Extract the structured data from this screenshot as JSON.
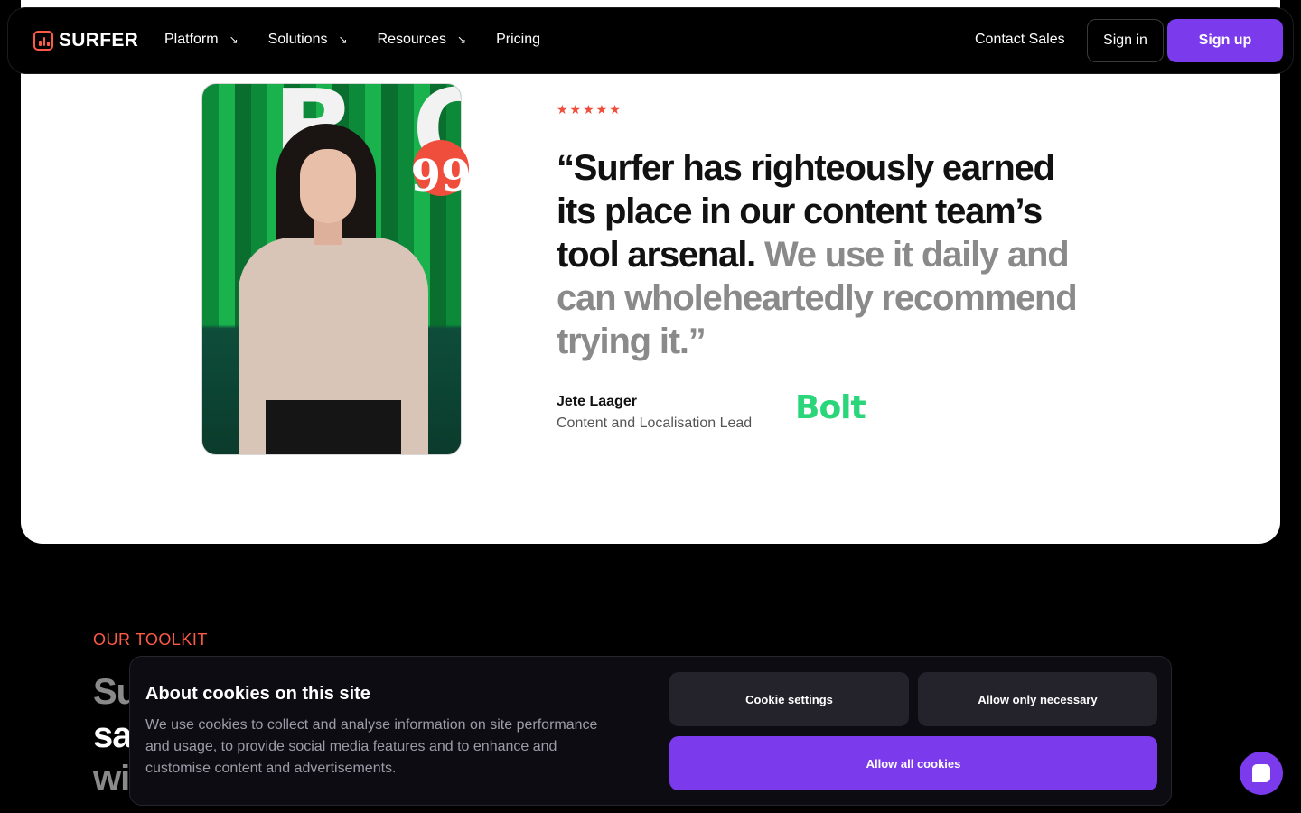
{
  "nav": {
    "logo_text": "SURFER",
    "links": [
      {
        "label": "Platform",
        "arrow": "↘"
      },
      {
        "label": "Solutions",
        "arrow": "↘"
      },
      {
        "label": "Resources",
        "arrow": "↘"
      },
      {
        "label": "Pricing",
        "arrow": ""
      }
    ],
    "contact_sales": "Contact Sales",
    "sign_in": "Sign in",
    "sign_up": "Sign up"
  },
  "testimonial": {
    "rating_stars": "★★★★★",
    "quote_mark": "99",
    "quote_strong": "“Surfer has righteously earned its place in our content team’s tool arsenal.",
    "quote_muted": " We use it daily and can wholeheartedly recommend trying it.”",
    "author_name": "Jete Laager",
    "author_role": "Content and Localisation Lead",
    "company": "Bolt",
    "photo_letters": [
      "B",
      "O"
    ]
  },
  "toolkit": {
    "eyebrow": "OUR TOOLKIT",
    "heading_line1": "Su",
    "heading_line2": "sa",
    "heading_line3": "wi"
  },
  "cookie_banner": {
    "title": "About cookies on this site",
    "text": "We use cookies to collect and analyse information on site performance and usage, to provide social media features and to enhance and customise content and advertisements.",
    "settings_label": "Cookie settings",
    "necessary_label": "Allow only necessary",
    "allow_all_label": "Allow all cookies"
  },
  "colors": {
    "accent_purple": "#7c3aed",
    "accent_red": "#ef4e3d",
    "brand_green": "#2bd67b"
  }
}
